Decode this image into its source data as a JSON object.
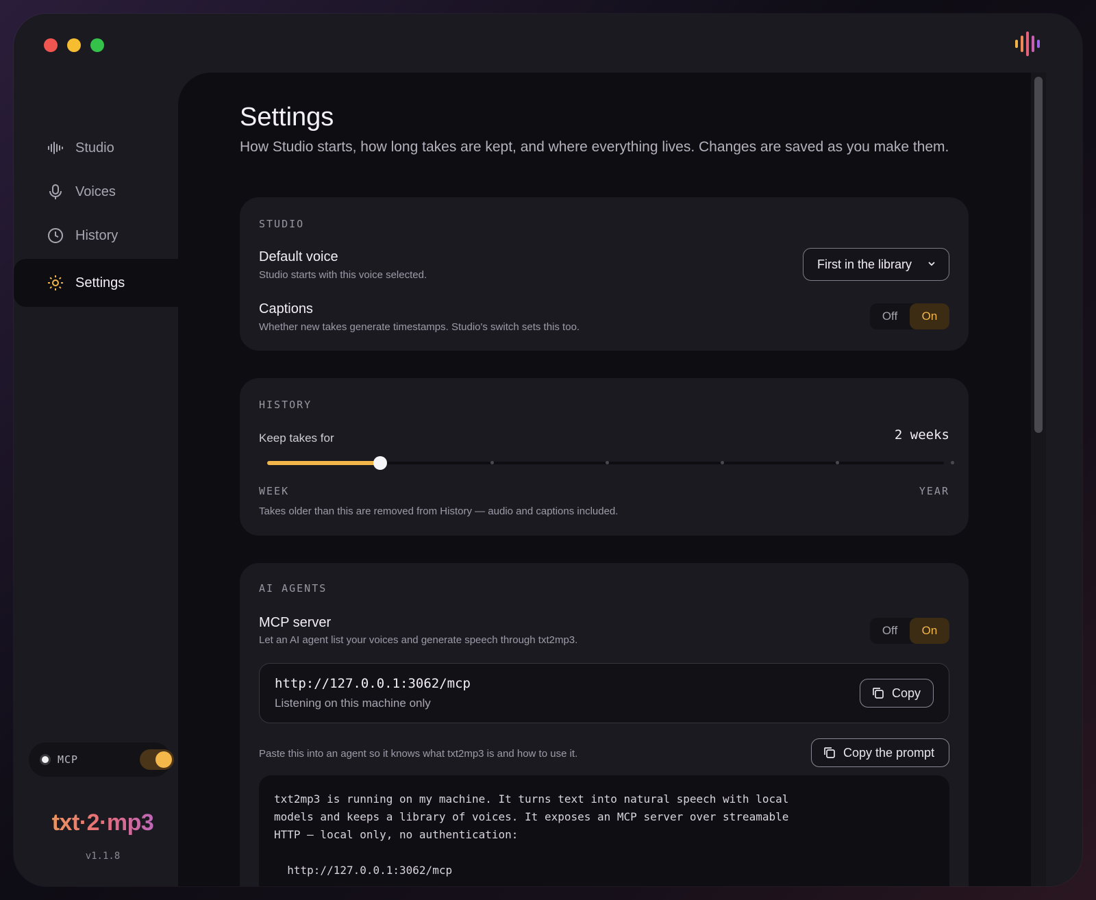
{
  "sidebar": {
    "items": [
      {
        "label": "Studio",
        "icon": "waveform-icon"
      },
      {
        "label": "Voices",
        "icon": "microphone-icon"
      },
      {
        "label": "History",
        "icon": "clock-icon"
      },
      {
        "label": "Settings",
        "icon": "sun-gear-icon",
        "active": true
      }
    ],
    "mcp_label": "MCP",
    "brand": "txt·2·mp3",
    "version": "v1.1.8"
  },
  "page": {
    "title": "Settings",
    "subtitle": "How Studio starts, how long takes are kept, and where everything lives. Changes are saved as you make them."
  },
  "studio": {
    "heading": "STUDIO",
    "default_voice": {
      "title": "Default voice",
      "desc": "Studio starts with this voice selected.",
      "value": "First in the library"
    },
    "captions": {
      "title": "Captions",
      "desc": "Whether new takes generate timestamps. Studio's switch sets this too.",
      "off": "Off",
      "on": "On",
      "selected": "On"
    }
  },
  "history": {
    "heading": "HISTORY",
    "keep_label": "Keep takes for",
    "keep_value": "2 weeks",
    "slider_position": 0.167,
    "min_label": "WEEK",
    "max_label": "YEAR",
    "desc": "Takes older than this are removed from History — audio and captions included."
  },
  "ai_agents": {
    "heading": "AI AGENTS",
    "mcp": {
      "title": "MCP server",
      "desc": "Let an AI agent list your voices and generate speech through txt2mp3.",
      "off": "Off",
      "on": "On",
      "selected": "On"
    },
    "url": "http://127.0.0.1:3062/mcp",
    "url_sub": "Listening on this machine only",
    "copy_label": "Copy",
    "prompt_hint": "Paste this into an agent so it knows what txt2mp3 is and how to use it.",
    "copy_prompt_label": "Copy the prompt",
    "prompt_text": "txt2mp3 is running on my machine. It turns text into natural speech with local\nmodels and keeps a library of voices. It exposes an MCP server over streamable\nHTTP — local only, no authentication:\n\n  http://127.0.0.1:3062/mcp"
  },
  "colors": {
    "accent": "#f1b54a",
    "window_bg": "#1b1a20",
    "panel_bg": "#0e0d12"
  }
}
